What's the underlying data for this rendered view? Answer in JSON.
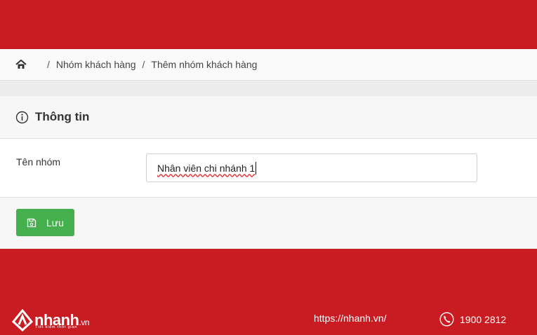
{
  "breadcrumb": {
    "home_icon": "home-icon",
    "separator": "/",
    "items": [
      "Nhóm khách hàng",
      "Thêm nhóm khách hàng"
    ]
  },
  "card": {
    "title": "Thông tin",
    "title_icon": "info-circle-icon",
    "field_label": "Tên nhóm",
    "field_value": "Nhân viên chi nhánh 1",
    "save_label": "Lưu",
    "save_icon": "save-icon"
  },
  "footer": {
    "brand": "nhanh",
    "brand_tld": ".vn",
    "tagline": "Tiết kiệm thời gian",
    "url": "https://nhanh.vn/",
    "phone": "1900 2812",
    "phone_icon": "phone-icon"
  },
  "colors": {
    "background": "#c91c22",
    "save_button": "#45b04d"
  }
}
